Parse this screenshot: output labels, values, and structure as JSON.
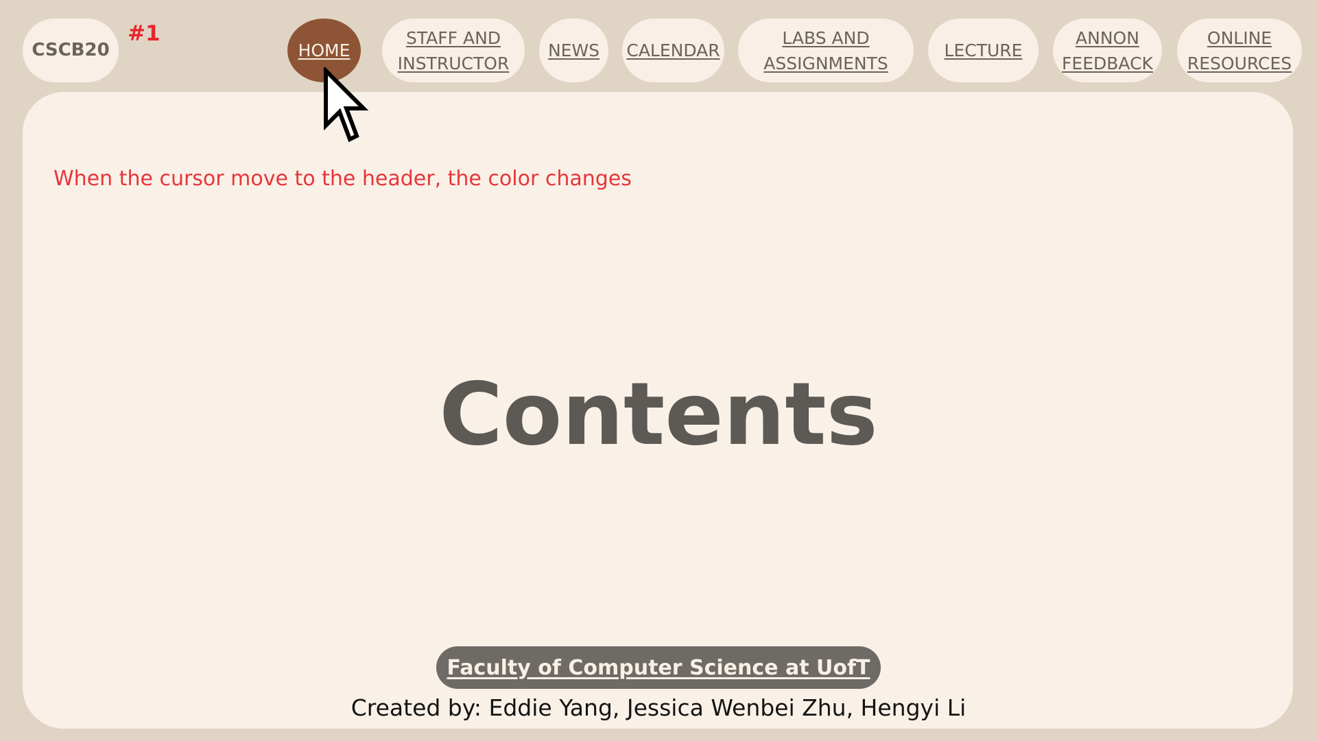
{
  "header": {
    "brand": "CSCB20",
    "annotation_number": "#1",
    "nav": [
      {
        "line1": "HOME",
        "line2": ""
      },
      {
        "line1": "STAFF AND",
        "line2": "INSTRUCTOR"
      },
      {
        "line1": "NEWS",
        "line2": ""
      },
      {
        "line1": "CALENDAR",
        "line2": ""
      },
      {
        "line1": "LABS AND",
        "line2": "ASSIGNMENTS"
      },
      {
        "line1": "LECTURE",
        "line2": ""
      },
      {
        "line1": "ANNON",
        "line2": "FEEDBACK"
      },
      {
        "line1": "ONLINE",
        "line2": "RESOURCES"
      }
    ]
  },
  "main": {
    "annotation_note": "When the cursor move to the header, the color changes",
    "title": "Contents"
  },
  "footer": {
    "link_label": "Faculty of Computer Science at UofT",
    "credits": "Created by: Eddie Yang, Jessica Wenbei Zhu, Hengyi Li"
  },
  "colors": {
    "background": "#e0d5c4",
    "panel": "#f9f1e8",
    "pill": "#f8f0e6",
    "active_pill": "#8d5435",
    "annotation": "#e8262e",
    "footer_pill": "#6e6a66"
  },
  "icons": {
    "cursor": "arrow-cursor-icon"
  }
}
